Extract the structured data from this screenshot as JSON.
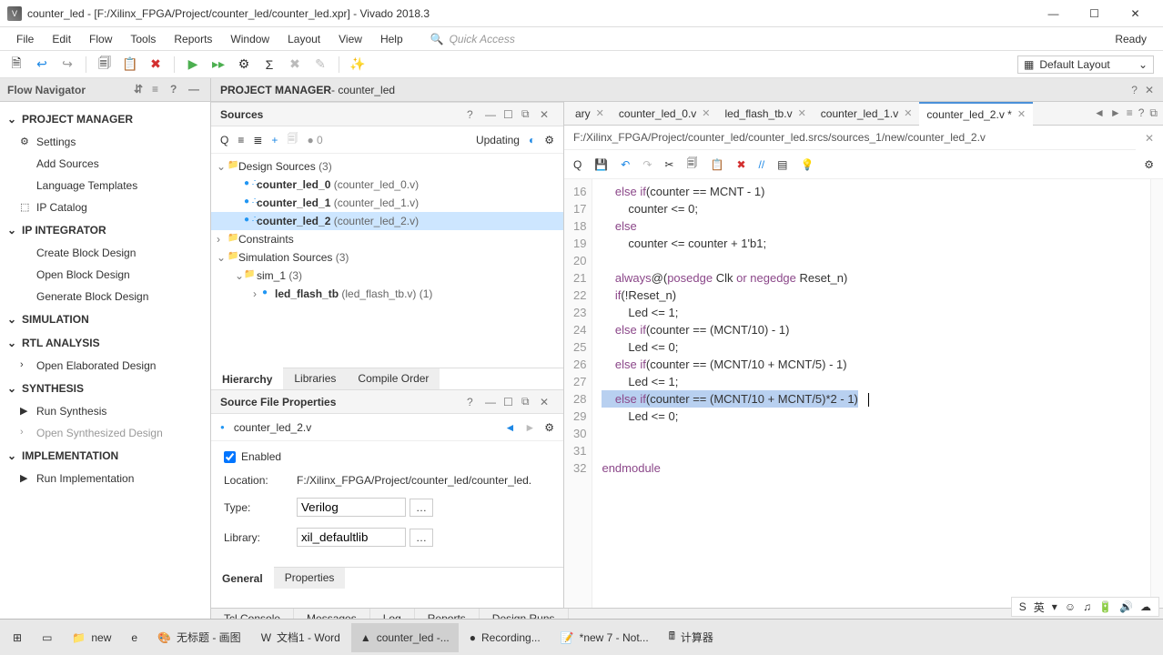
{
  "window": {
    "title": "counter_led - [F:/Xilinx_FPGA/Project/counter_led/counter_led.xpr] - Vivado 2018.3"
  },
  "menubar": {
    "items": [
      "File",
      "Edit",
      "Flow",
      "Tools",
      "Reports",
      "Window",
      "Layout",
      "View",
      "Help"
    ],
    "quick_access": "Quick Access",
    "ready": "Ready"
  },
  "layout_combo": "Default Layout",
  "flow_nav": {
    "title": "Flow Navigator",
    "sections": [
      {
        "title": "PROJECT MANAGER",
        "items": [
          {
            "label": "Settings",
            "icon": "⚙"
          },
          {
            "label": "Add Sources",
            "icon": ""
          },
          {
            "label": "Language Templates",
            "icon": ""
          },
          {
            "label": "IP Catalog",
            "icon": "⬚"
          }
        ]
      },
      {
        "title": "IP INTEGRATOR",
        "items": [
          {
            "label": "Create Block Design",
            "icon": ""
          },
          {
            "label": "Open Block Design",
            "icon": ""
          },
          {
            "label": "Generate Block Design",
            "icon": ""
          }
        ]
      },
      {
        "title": "SIMULATION",
        "items": []
      },
      {
        "title": "RTL ANALYSIS",
        "items": [
          {
            "label": "Open Elaborated Design",
            "icon": "›"
          }
        ]
      },
      {
        "title": "SYNTHESIS",
        "items": [
          {
            "label": "Run Synthesis",
            "icon": "▶"
          },
          {
            "label": "Open Synthesized Design",
            "icon": "›",
            "disabled": true
          }
        ]
      },
      {
        "title": "IMPLEMENTATION",
        "items": [
          {
            "label": "Run Implementation",
            "icon": "▶"
          }
        ]
      }
    ]
  },
  "pm": {
    "title": "PROJECT MANAGER",
    "project": " - counter_led"
  },
  "sources": {
    "title": "Sources",
    "updating": "Updating",
    "badge": "0",
    "tree": {
      "design_sources": {
        "label": "Design Sources",
        "count": "(3)"
      },
      "items": [
        {
          "name": "counter_led_0",
          "file": "(counter_led_0.v)"
        },
        {
          "name": "counter_led_1",
          "file": "(counter_led_1.v)"
        },
        {
          "name": "counter_led_2",
          "file": "(counter_led_2.v)",
          "selected": true
        }
      ],
      "constraints": "Constraints",
      "sim_sources": {
        "label": "Simulation Sources",
        "count": "(3)"
      },
      "sim1": {
        "label": "sim_1",
        "count": "(3)"
      },
      "tb": {
        "name": "led_flash_tb",
        "file": "(led_flash_tb.v) (1)"
      }
    },
    "footer_tabs": [
      "Hierarchy",
      "Libraries",
      "Compile Order"
    ]
  },
  "props": {
    "title": "Source File Properties",
    "file": "counter_led_2.v",
    "enabled": "Enabled",
    "location_label": "Location:",
    "location": "F:/Xilinx_FPGA/Project/counter_led/counter_led.",
    "type_label": "Type:",
    "type": "Verilog",
    "library_label": "Library:",
    "library": "xil_defaultlib",
    "footer_tabs": [
      "General",
      "Properties"
    ]
  },
  "editor": {
    "tabs": [
      {
        "label": "ary",
        "close": true
      },
      {
        "label": "counter_led_0.v",
        "close": true
      },
      {
        "label": "led_flash_tb.v",
        "close": true
      },
      {
        "label": "counter_led_1.v",
        "close": true
      },
      {
        "label": "counter_led_2.v *",
        "close": true,
        "active": true
      }
    ],
    "path": "F:/Xilinx_FPGA/Project/counter_led/counter_led.srcs/sources_1/new/counter_led_2.v",
    "lines": [
      {
        "n": 16,
        "t": "    else if(counter == MCNT - 1)"
      },
      {
        "n": 17,
        "t": "        counter <= 0;"
      },
      {
        "n": 18,
        "t": "    else"
      },
      {
        "n": 19,
        "t": "        counter <= counter + 1'b1;"
      },
      {
        "n": 20,
        "t": "    "
      },
      {
        "n": 21,
        "t": "    always@(posedge Clk or negedge Reset_n)"
      },
      {
        "n": 22,
        "t": "    if(!Reset_n)"
      },
      {
        "n": 23,
        "t": "        Led <= 1;"
      },
      {
        "n": 24,
        "t": "    else if(counter == (MCNT/10) - 1)"
      },
      {
        "n": 25,
        "t": "        Led <= 0;"
      },
      {
        "n": 26,
        "t": "    else if(counter == (MCNT/10 + MCNT/5) - 1)"
      },
      {
        "n": 27,
        "t": "        Led <= 1;"
      },
      {
        "n": 28,
        "t": "    else if(counter == (MCNT/10 + MCNT/5)*2 - 1)",
        "selected": true
      },
      {
        "n": 29,
        "t": "        Led <= 0;"
      },
      {
        "n": 30,
        "t": ""
      },
      {
        "n": 31,
        "t": ""
      },
      {
        "n": 32,
        "t": "endmodule"
      }
    ]
  },
  "bottom_tabs": [
    "Tcl Console",
    "Messages",
    "Log",
    "Reports",
    "Design Runs"
  ],
  "taskbar": {
    "items": [
      {
        "label": "",
        "icon": "⊞"
      },
      {
        "label": "",
        "icon": "▭"
      },
      {
        "label": "new",
        "icon": "📁"
      },
      {
        "label": "",
        "icon": "e"
      },
      {
        "label": "无标题 - 画图",
        "icon": "🎨"
      },
      {
        "label": "文档1 - Word",
        "icon": "W"
      },
      {
        "label": "counter_led -...",
        "icon": "▲",
        "active": true
      },
      {
        "label": "Recording...",
        "icon": "●"
      },
      {
        "label": "*new 7 - Not...",
        "icon": "📝"
      },
      {
        "label": "计算器",
        "icon": "🖩"
      }
    ]
  },
  "systray": {
    "items": [
      "S",
      "英",
      "▾",
      "☺",
      "♫",
      "🔋",
      "🔊",
      "☁"
    ]
  }
}
